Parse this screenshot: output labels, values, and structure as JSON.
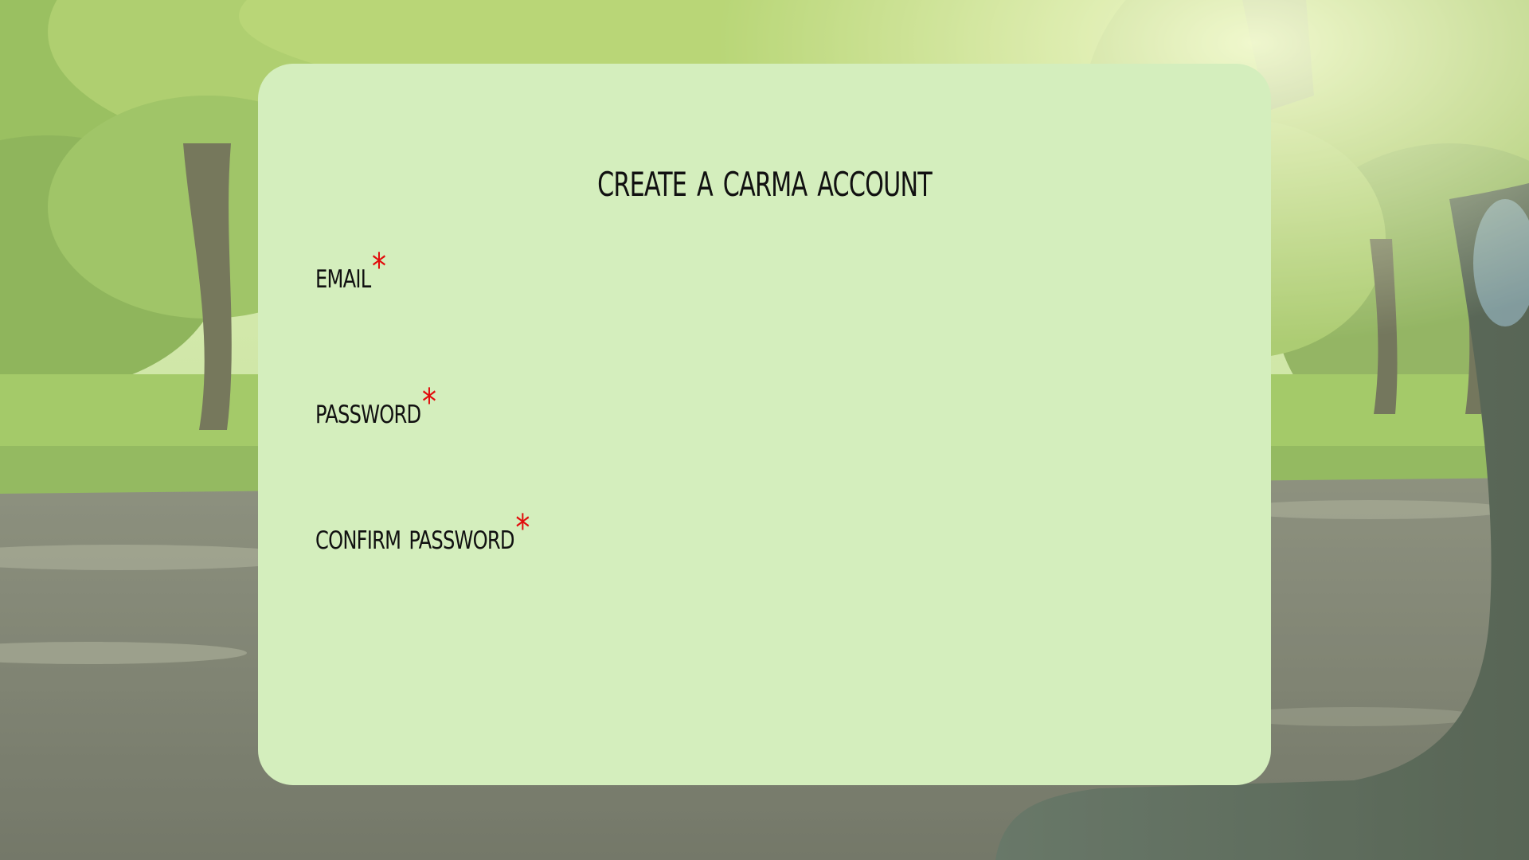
{
  "page": {
    "title": "create a carma account"
  },
  "form": {
    "fields": [
      {
        "label": "email",
        "required_marker": "*",
        "value": "",
        "placeholder": ""
      },
      {
        "label": "password",
        "required_marker": "*",
        "value": "",
        "placeholder": ""
      },
      {
        "label": "confirm password",
        "required_marker": "*",
        "value": "",
        "placeholder": ""
      }
    ]
  },
  "colors": {
    "card_background": "#d4eebd",
    "text": "#111111",
    "required_marker": "#e20b0b"
  },
  "background": {
    "icon": "park-road-car-image"
  }
}
